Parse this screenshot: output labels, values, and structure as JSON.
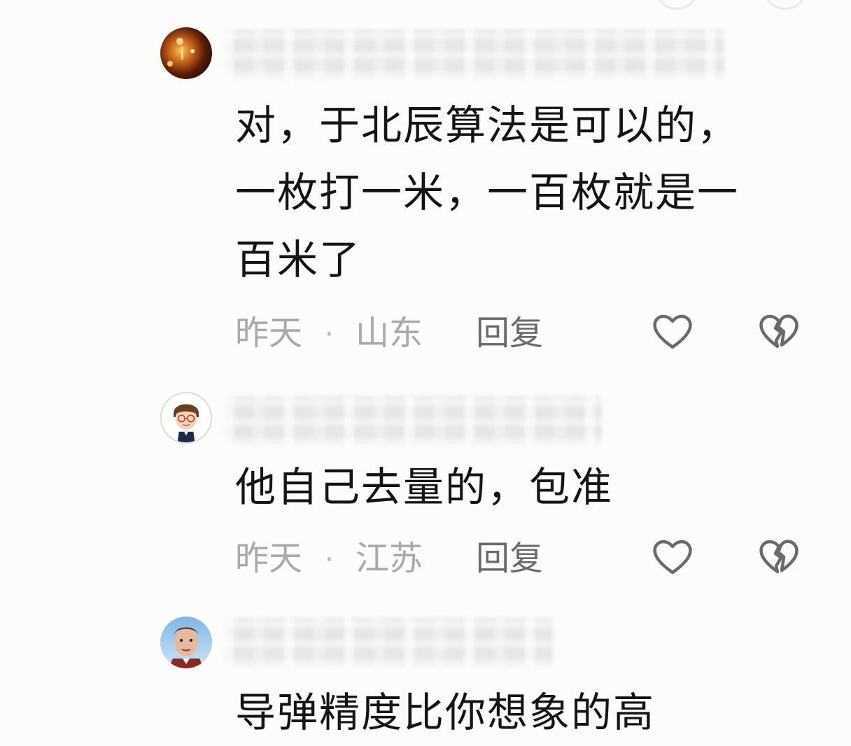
{
  "comments": [
    {
      "text_lines": [
        "对，于北辰算法是可以的，",
        "一枚打一米，一百枚就是一",
        "百米了"
      ],
      "time": "昨天",
      "separator": "·",
      "location": "山东",
      "reply_label": "回复"
    },
    {
      "text_lines": [
        "他自己去量的，包准"
      ],
      "time": "昨天",
      "separator": "·",
      "location": "江苏",
      "reply_label": "回复"
    },
    {
      "text_lines": [
        "导弹精度比你想象的高"
      ]
    }
  ],
  "icons": {
    "like": "heart-outline-icon",
    "dislike": "broken-heart-icon"
  },
  "colors": {
    "text": "#141414",
    "meta": "#a9a9a9",
    "reply": "#6a6a6a",
    "icon_stroke": "#6a6a6a"
  }
}
